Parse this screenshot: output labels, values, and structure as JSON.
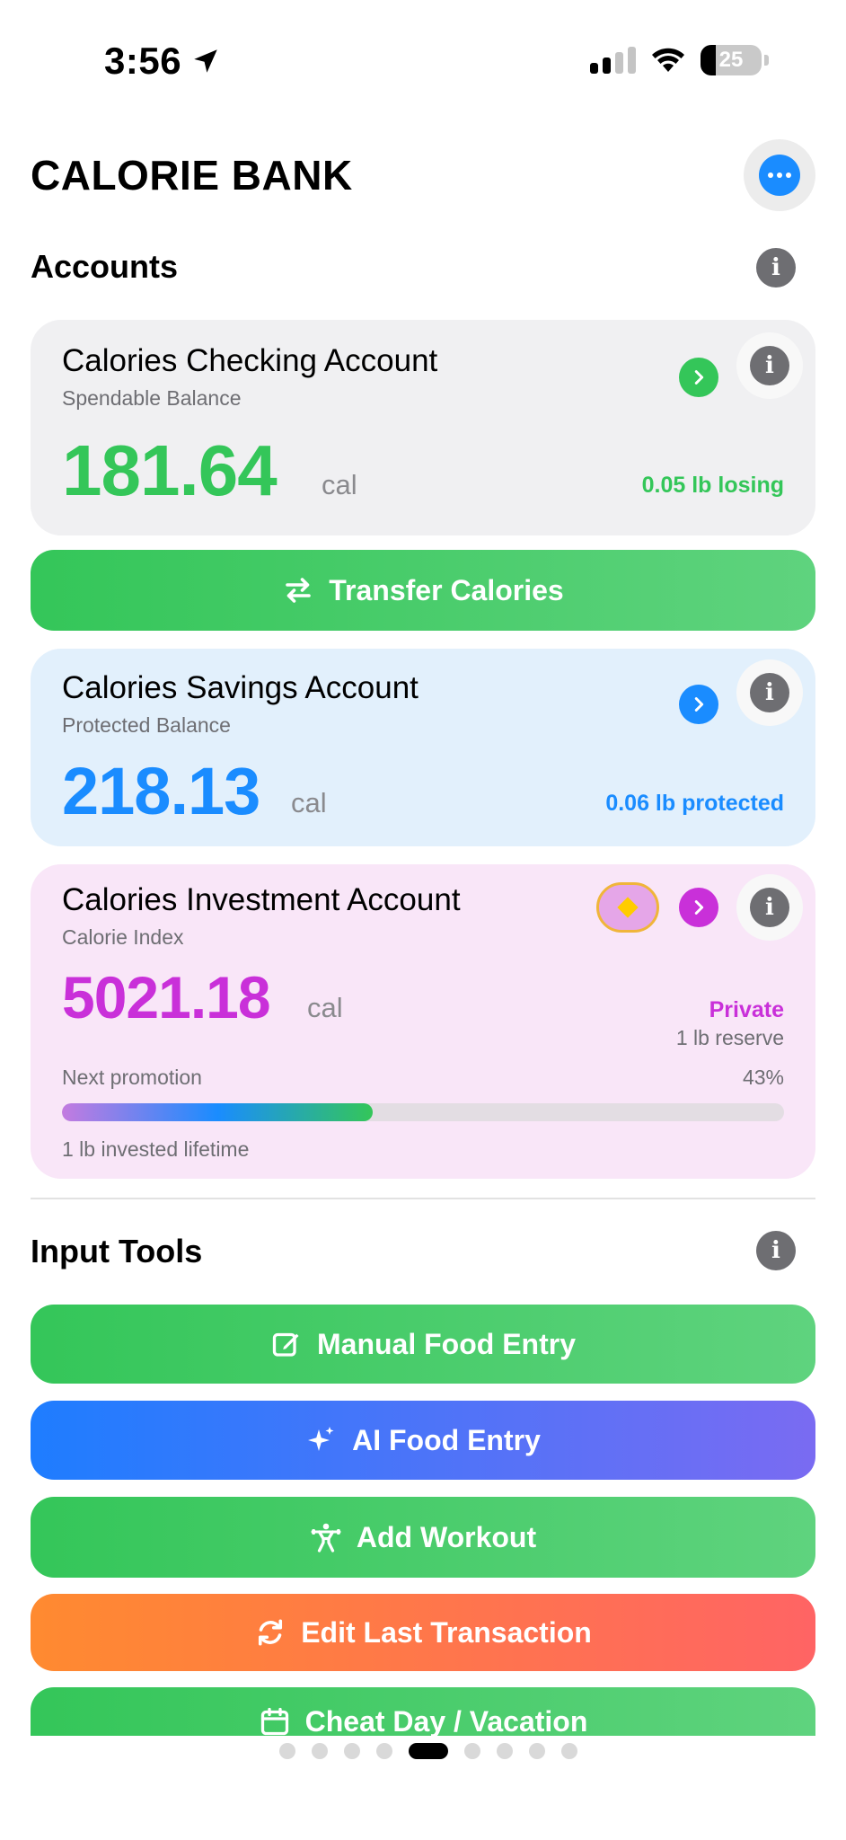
{
  "status_bar": {
    "time": "3:56",
    "battery": "25"
  },
  "header": {
    "title": "CALORIE BANK"
  },
  "accounts_section": {
    "title": "Accounts"
  },
  "checking": {
    "title": "Calories Checking Account",
    "subtitle": "Spendable Balance",
    "balance": "181.64",
    "unit": "cal",
    "status": "0.05 lb losing",
    "accent": "#34c659"
  },
  "transfer": {
    "label": "Transfer Calories"
  },
  "savings": {
    "title": "Calories Savings Account",
    "subtitle": "Protected Balance",
    "balance": "218.13",
    "unit": "cal",
    "status": "0.06 lb protected",
    "accent": "#1a8cff"
  },
  "investment": {
    "title": "Calories Investment Account",
    "subtitle": "Calorie Index",
    "balance": "5021.18",
    "unit": "cal",
    "tier": "Private",
    "reserve": "1 lb reserve",
    "promotion_label": "Next promotion",
    "promotion_percent": "43%",
    "promotion_progress": 0.43,
    "lifetime": "1 lb invested lifetime",
    "accent": "#c930d9"
  },
  "input_tools": {
    "title": "Input Tools",
    "buttons": [
      {
        "label": "Manual Food Entry",
        "icon": "edit-icon"
      },
      {
        "label": "AI Food Entry",
        "icon": "sparkles-icon"
      },
      {
        "label": "Add Workout",
        "icon": "weightlifter-icon"
      },
      {
        "label": "Edit Last Transaction",
        "icon": "refresh-icon"
      },
      {
        "label": "Cheat Day / Vacation",
        "icon": "calendar-icon"
      }
    ]
  },
  "pagination": {
    "total": 9,
    "current": 5
  }
}
